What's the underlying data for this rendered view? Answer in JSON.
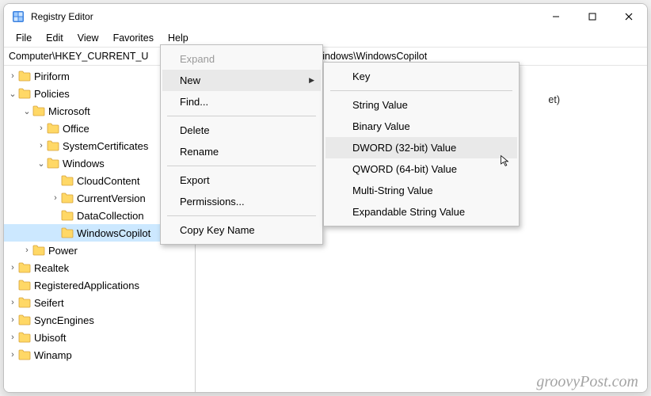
{
  "window": {
    "title": "Registry Editor"
  },
  "menubar": [
    "File",
    "Edit",
    "View",
    "Favorites",
    "Help"
  ],
  "addressbar": {
    "prefix": "Computer\\HKEY_CURRENT_U",
    "suffix": "Windows\\WindowsCopilot"
  },
  "tree": [
    {
      "label": "Piriform",
      "indent": 0,
      "twist": ">",
      "sel": false
    },
    {
      "label": "Policies",
      "indent": 0,
      "twist": "v",
      "sel": false
    },
    {
      "label": "Microsoft",
      "indent": 1,
      "twist": "v",
      "sel": false
    },
    {
      "label": "Office",
      "indent": 2,
      "twist": ">",
      "sel": false
    },
    {
      "label": "SystemCertificates",
      "indent": 2,
      "twist": ">",
      "sel": false
    },
    {
      "label": "Windows",
      "indent": 2,
      "twist": "v",
      "sel": false
    },
    {
      "label": "CloudContent",
      "indent": 3,
      "twist": "",
      "sel": false
    },
    {
      "label": "CurrentVersion",
      "indent": 3,
      "twist": ">",
      "sel": false
    },
    {
      "label": "DataCollection",
      "indent": 3,
      "twist": "",
      "sel": false
    },
    {
      "label": "WindowsCopilot",
      "indent": 3,
      "twist": "",
      "sel": true
    },
    {
      "label": "Power",
      "indent": 1,
      "twist": ">",
      "sel": false
    },
    {
      "label": "Realtek",
      "indent": 0,
      "twist": ">",
      "sel": false
    },
    {
      "label": "RegisteredApplications",
      "indent": 0,
      "twist": "",
      "sel": false
    },
    {
      "label": "Seifert",
      "indent": 0,
      "twist": ">",
      "sel": false
    },
    {
      "label": "SyncEngines",
      "indent": 0,
      "twist": ">",
      "sel": false
    },
    {
      "label": "Ubisoft",
      "indent": 0,
      "twist": ">",
      "sel": false
    },
    {
      "label": "Winamp",
      "indent": 0,
      "twist": ">",
      "sel": false
    }
  ],
  "list": {
    "partial_value": "et)"
  },
  "ctx1": [
    {
      "label": "Expand",
      "disabled": true
    },
    {
      "label": "New",
      "hl": true,
      "arrow": true
    },
    {
      "label": "Find...",
      "sepAfter": true
    },
    {
      "label": "Delete"
    },
    {
      "label": "Rename",
      "sepAfter": true
    },
    {
      "label": "Export"
    },
    {
      "label": "Permissions...",
      "sepAfter": true
    },
    {
      "label": "Copy Key Name"
    }
  ],
  "ctx2": [
    {
      "label": "Key",
      "sepAfter": true
    },
    {
      "label": "String Value"
    },
    {
      "label": "Binary Value"
    },
    {
      "label": "DWORD (32-bit) Value",
      "hl": true
    },
    {
      "label": "QWORD (64-bit) Value"
    },
    {
      "label": "Multi-String Value"
    },
    {
      "label": "Expandable String Value"
    }
  ],
  "watermark": "groovyPost.com"
}
